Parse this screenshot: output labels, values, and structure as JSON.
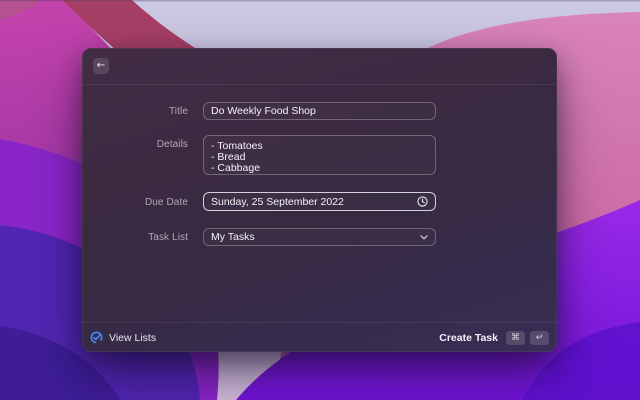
{
  "window": {
    "header": {
      "back_icon": "←"
    },
    "form": {
      "title": {
        "label": "Title",
        "value": "Do Weekly Food Shop"
      },
      "details": {
        "label": "Details",
        "value": "- Tomatoes\n- Bread\n- Cabbage"
      },
      "due_date": {
        "label": "Due Date",
        "value": "Sunday, 25 September 2022"
      },
      "task_list": {
        "label": "Task List",
        "value": "My Tasks"
      }
    },
    "footer": {
      "view_lists_label": "View Lists",
      "create_task_label": "Create Task",
      "shortcut_keys": [
        "⌘",
        "↵"
      ]
    }
  },
  "colors": {
    "accent_blue": "#4186f5"
  }
}
